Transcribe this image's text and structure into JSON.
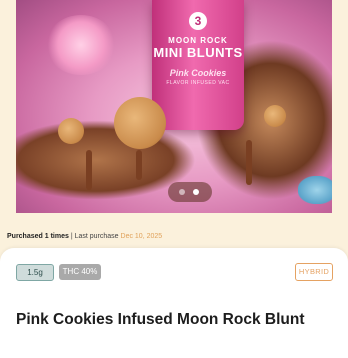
{
  "hero": {
    "can_number": "3",
    "can_brand_line1": "MOON ROCK",
    "can_brand_line2": "MINI BLUNTS",
    "can_flavor": "Pink Cookies",
    "can_subline": "FLAVOR  INFUSED  VAC",
    "carousel": {
      "count": 2,
      "active_index": 1
    }
  },
  "purchase": {
    "count_text": "Purchased 1 times",
    "separator": " | ",
    "last_purchase_label": "Last purchase ",
    "last_purchase_date": "Dec 10, 2025"
  },
  "product": {
    "weight": "1.5g",
    "thc": "THC 40%",
    "strain_type": "HYBRID",
    "name": "Pink Cookies Infused Moon Rock Blunt"
  },
  "colors": {
    "page_background": "#fbf1dc",
    "date_accent": "#e0a25b",
    "strain_badge": "#e5a262",
    "weight_chip_border": "#7fa7a4",
    "thc_chip": "#a9a9a9"
  }
}
